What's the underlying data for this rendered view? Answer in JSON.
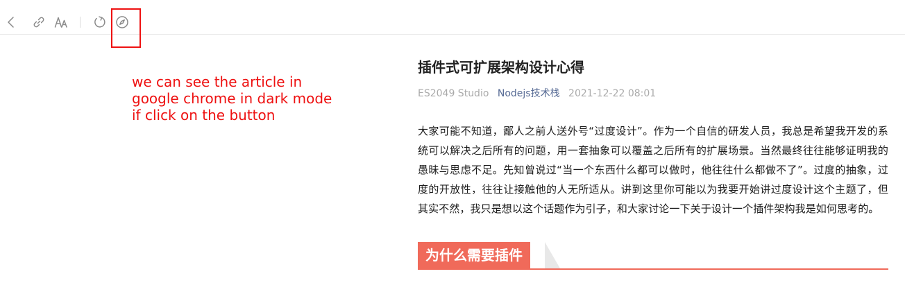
{
  "toolbar": {
    "icons": [
      "chevron-left-icon",
      "link-icon",
      "font-size-icon",
      "refresh-icon",
      "compass-icon"
    ]
  },
  "annotation": {
    "note": "we can see the article in\ngoogle chrome in dark mode\nif click on the button",
    "color": "#ee1111"
  },
  "article": {
    "title": "插件式可扩展架构设计心得",
    "meta": {
      "author": "ES2049 Studio",
      "account": "Nodejs技术栈",
      "date": "2021-12-22 08:01"
    },
    "paragraph": "大家可能不知道，鄙人之前人送外号“过度设计”。作为一个自信的研发人员，我总是希望我开发的系统可以解决之后所有的问题，用一套抽象可以覆盖之后所有的扩展场景。当然最终往往能够证明我的愚昧与思虑不足。先知曾说过“当一个东西什么都可以做时，他往往什么都做不了”。过度的抽象，过度的开放性，往往让接触他的人无所适从。讲到这里你可能以为我要开始讲过度设计这个主题了，但其实不然，我只是想以这个话题作为引子，和大家讨论一下关于设计一个插件架构我是如何思考的。",
    "section_heading": "为什么需要插件"
  },
  "colors": {
    "accent": "#f06a5a",
    "account_link": "#576b95",
    "meta_text": "#aaaaaa"
  }
}
